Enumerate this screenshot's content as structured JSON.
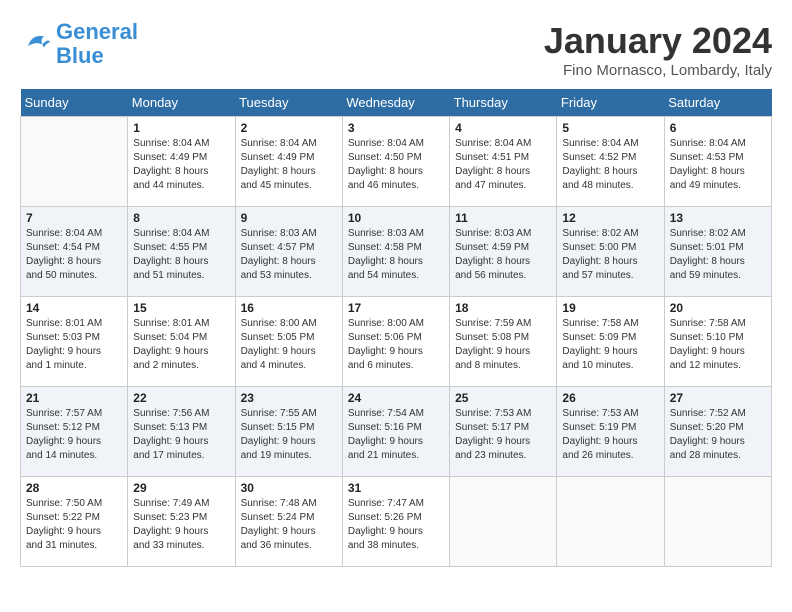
{
  "logo": {
    "text_general": "General",
    "text_blue": "Blue"
  },
  "title": "January 2024",
  "location": "Fino Mornasco, Lombardy, Italy",
  "days_of_week": [
    "Sunday",
    "Monday",
    "Tuesday",
    "Wednesday",
    "Thursday",
    "Friday",
    "Saturday"
  ],
  "weeks": [
    [
      {
        "day": "",
        "info": ""
      },
      {
        "day": "1",
        "info": "Sunrise: 8:04 AM\nSunset: 4:49 PM\nDaylight: 8 hours\nand 44 minutes."
      },
      {
        "day": "2",
        "info": "Sunrise: 8:04 AM\nSunset: 4:49 PM\nDaylight: 8 hours\nand 45 minutes."
      },
      {
        "day": "3",
        "info": "Sunrise: 8:04 AM\nSunset: 4:50 PM\nDaylight: 8 hours\nand 46 minutes."
      },
      {
        "day": "4",
        "info": "Sunrise: 8:04 AM\nSunset: 4:51 PM\nDaylight: 8 hours\nand 47 minutes."
      },
      {
        "day": "5",
        "info": "Sunrise: 8:04 AM\nSunset: 4:52 PM\nDaylight: 8 hours\nand 48 minutes."
      },
      {
        "day": "6",
        "info": "Sunrise: 8:04 AM\nSunset: 4:53 PM\nDaylight: 8 hours\nand 49 minutes."
      }
    ],
    [
      {
        "day": "7",
        "info": "Sunrise: 8:04 AM\nSunset: 4:54 PM\nDaylight: 8 hours\nand 50 minutes."
      },
      {
        "day": "8",
        "info": "Sunrise: 8:04 AM\nSunset: 4:55 PM\nDaylight: 8 hours\nand 51 minutes."
      },
      {
        "day": "9",
        "info": "Sunrise: 8:03 AM\nSunset: 4:57 PM\nDaylight: 8 hours\nand 53 minutes."
      },
      {
        "day": "10",
        "info": "Sunrise: 8:03 AM\nSunset: 4:58 PM\nDaylight: 8 hours\nand 54 minutes."
      },
      {
        "day": "11",
        "info": "Sunrise: 8:03 AM\nSunset: 4:59 PM\nDaylight: 8 hours\nand 56 minutes."
      },
      {
        "day": "12",
        "info": "Sunrise: 8:02 AM\nSunset: 5:00 PM\nDaylight: 8 hours\nand 57 minutes."
      },
      {
        "day": "13",
        "info": "Sunrise: 8:02 AM\nSunset: 5:01 PM\nDaylight: 8 hours\nand 59 minutes."
      }
    ],
    [
      {
        "day": "14",
        "info": "Sunrise: 8:01 AM\nSunset: 5:03 PM\nDaylight: 9 hours\nand 1 minute."
      },
      {
        "day": "15",
        "info": "Sunrise: 8:01 AM\nSunset: 5:04 PM\nDaylight: 9 hours\nand 2 minutes."
      },
      {
        "day": "16",
        "info": "Sunrise: 8:00 AM\nSunset: 5:05 PM\nDaylight: 9 hours\nand 4 minutes."
      },
      {
        "day": "17",
        "info": "Sunrise: 8:00 AM\nSunset: 5:06 PM\nDaylight: 9 hours\nand 6 minutes."
      },
      {
        "day": "18",
        "info": "Sunrise: 7:59 AM\nSunset: 5:08 PM\nDaylight: 9 hours\nand 8 minutes."
      },
      {
        "day": "19",
        "info": "Sunrise: 7:58 AM\nSunset: 5:09 PM\nDaylight: 9 hours\nand 10 minutes."
      },
      {
        "day": "20",
        "info": "Sunrise: 7:58 AM\nSunset: 5:10 PM\nDaylight: 9 hours\nand 12 minutes."
      }
    ],
    [
      {
        "day": "21",
        "info": "Sunrise: 7:57 AM\nSunset: 5:12 PM\nDaylight: 9 hours\nand 14 minutes."
      },
      {
        "day": "22",
        "info": "Sunrise: 7:56 AM\nSunset: 5:13 PM\nDaylight: 9 hours\nand 17 minutes."
      },
      {
        "day": "23",
        "info": "Sunrise: 7:55 AM\nSunset: 5:15 PM\nDaylight: 9 hours\nand 19 minutes."
      },
      {
        "day": "24",
        "info": "Sunrise: 7:54 AM\nSunset: 5:16 PM\nDaylight: 9 hours\nand 21 minutes."
      },
      {
        "day": "25",
        "info": "Sunrise: 7:53 AM\nSunset: 5:17 PM\nDaylight: 9 hours\nand 23 minutes."
      },
      {
        "day": "26",
        "info": "Sunrise: 7:53 AM\nSunset: 5:19 PM\nDaylight: 9 hours\nand 26 minutes."
      },
      {
        "day": "27",
        "info": "Sunrise: 7:52 AM\nSunset: 5:20 PM\nDaylight: 9 hours\nand 28 minutes."
      }
    ],
    [
      {
        "day": "28",
        "info": "Sunrise: 7:50 AM\nSunset: 5:22 PM\nDaylight: 9 hours\nand 31 minutes."
      },
      {
        "day": "29",
        "info": "Sunrise: 7:49 AM\nSunset: 5:23 PM\nDaylight: 9 hours\nand 33 minutes."
      },
      {
        "day": "30",
        "info": "Sunrise: 7:48 AM\nSunset: 5:24 PM\nDaylight: 9 hours\nand 36 minutes."
      },
      {
        "day": "31",
        "info": "Sunrise: 7:47 AM\nSunset: 5:26 PM\nDaylight: 9 hours\nand 38 minutes."
      },
      {
        "day": "",
        "info": ""
      },
      {
        "day": "",
        "info": ""
      },
      {
        "day": "",
        "info": ""
      }
    ]
  ]
}
